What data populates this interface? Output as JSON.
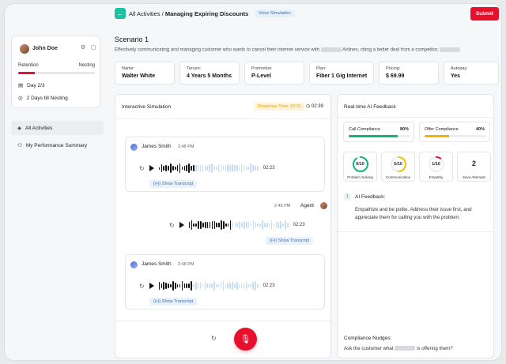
{
  "user": {
    "name": "John Doe",
    "stage_left": "Retention",
    "stage_right": "Nesting",
    "progress": 0.22,
    "day": "Day 2/3",
    "nesting": "2 Days till Nesting"
  },
  "nav": {
    "all_activities": "All Activities",
    "performance": "My Performance Summary"
  },
  "header": {
    "crumb_root": "All Activities",
    "crumb_sep": "/",
    "crumb_current": "Managing Expiring Discounts",
    "badge": "Voice Simulation",
    "submit": "Submit"
  },
  "scenario": {
    "title": "Scenario 1",
    "desc_a": "Effectively communicating and managing customer who wants to cancel their internet service with",
    "desc_b": "Airlines, citing a better deal from a competitor,"
  },
  "info": [
    {
      "label": "Name:",
      "value": "Walter White"
    },
    {
      "label": "Tenure:",
      "value": "4 Years 5 Months"
    },
    {
      "label": "Promotion:",
      "value": "P-Level"
    },
    {
      "label": "Plan:",
      "value": "Fiber 1 Gig Internet"
    },
    {
      "label": "Pricing:",
      "value": "$ 69.99"
    },
    {
      "label": "Autopay:",
      "value": "Yes"
    }
  ],
  "sim": {
    "title": "Interactive Simulation",
    "response_time": "Response Time: 00:31",
    "timer": "02:39",
    "messages": [
      {
        "name": "James Smith",
        "time": "2:48 PM",
        "duration": "02:23",
        "transcript": "Show Transcript"
      },
      {
        "name": "Agent",
        "time": "2:45 PM",
        "duration": "02:23",
        "transcript": "Show Transcript"
      },
      {
        "name": "James Smith",
        "time": "2:48 PM",
        "duration": "02:23",
        "transcript": "Show Transcript"
      }
    ]
  },
  "feedback": {
    "title": "Real-time AI Feedback",
    "call_compliance": {
      "label": "Call Compliance",
      "pct": "80%",
      "value": 0.8,
      "color": "#14b37a"
    },
    "offer_compliance": {
      "label": "Offer Compliance",
      "pct": "40%",
      "value": 0.4,
      "color": "#f3b400"
    },
    "scores": [
      {
        "value": "9/10",
        "label": "Problem Solving",
        "fraction": 0.9,
        "color": "#14b37a"
      },
      {
        "value": "5/10",
        "label": "Communication",
        "fraction": 0.5,
        "color": "#f3c000"
      },
      {
        "value": "1/10",
        "label": "Empathy",
        "fraction": 0.1,
        "color": "#e8112d"
      }
    ],
    "save_attempts": {
      "value": "2",
      "label": "Save Attempts"
    },
    "item_num": "1",
    "item_head": "AI Feedback:",
    "item_text": "Empathize and be polite. Address their issue first, and appreciate them for calling you with the problem.",
    "nudge_title": "Compliance  Nudges:",
    "nudge_a": "Ask the customer what",
    "nudge_b": "is offering them?"
  },
  "colors": {
    "accent": "#e8112d",
    "teal": "#19c2a0"
  }
}
